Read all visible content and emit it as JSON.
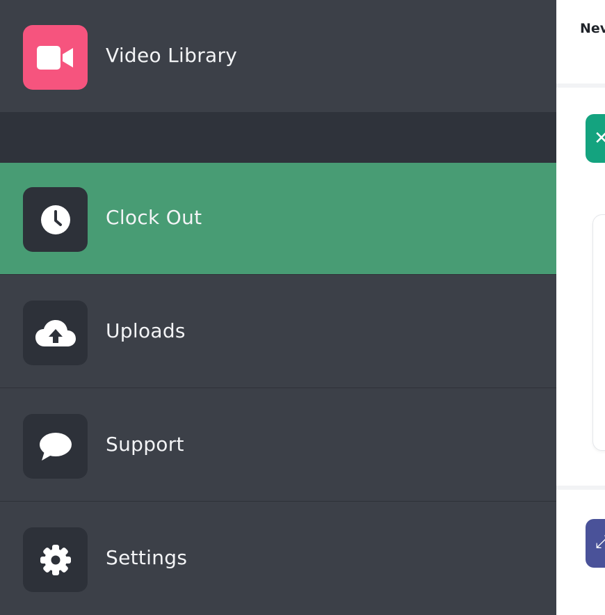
{
  "background_page": {
    "header_text": "Nev",
    "green_tile_glyph": "✕",
    "indigo_tile_glyph": "⤢"
  },
  "sidebar": {
    "items": [
      {
        "label": "Video Library",
        "icon": "video-camera-icon",
        "active": false,
        "icon_bg": "#f6547e"
      },
      {
        "label": "Clock Out",
        "icon": "clock-icon",
        "active": true,
        "active_bg": "#489c74"
      },
      {
        "label": "Uploads",
        "icon": "cloud-upload-icon",
        "active": false
      },
      {
        "label": "Support",
        "icon": "chat-bubble-icon",
        "active": false
      },
      {
        "label": "Settings",
        "icon": "gear-icon",
        "active": false
      }
    ]
  },
  "colors": {
    "sidebar_bg": "#3c4048",
    "icon_box_bg": "#2d3139",
    "active_bg": "#489c74",
    "video_icon_bg": "#f6547e",
    "text": "#f3f4f6"
  }
}
